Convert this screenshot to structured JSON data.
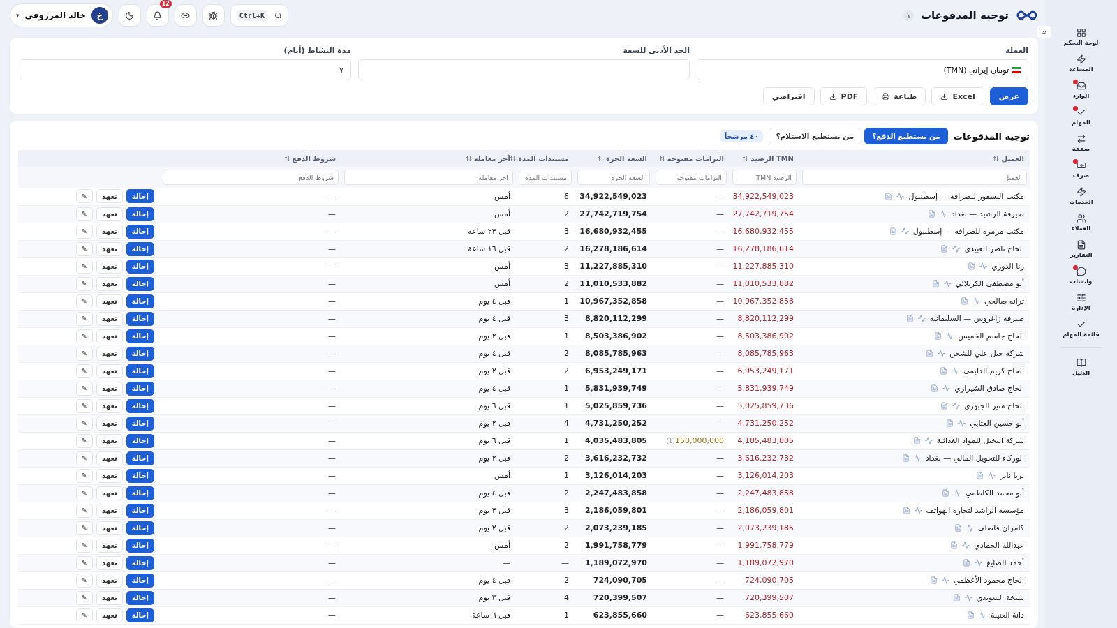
{
  "topbar": {
    "title": "توجيه المدفوعات",
    "help": "؟",
    "user": {
      "name": "خالد المرزوقي",
      "initial": "خ",
      "caret": "▾"
    },
    "notifications": "12",
    "search_shortcut": "Ctrl+K"
  },
  "sidebar": {
    "collapse": "«",
    "items": [
      {
        "label": "لوحة التحكم",
        "dot": false
      },
      {
        "label": "المساعد",
        "dot": false
      },
      {
        "label": "الوارد",
        "dot": true
      },
      {
        "label": "المهام",
        "dot": true
      },
      {
        "label": "صفقة",
        "dot": false
      },
      {
        "label": "صرف",
        "dot": true
      },
      {
        "label": "الخدمات",
        "dot": false
      },
      {
        "label": "العملاء",
        "dot": false
      },
      {
        "label": "التقارير",
        "dot": false
      },
      {
        "label": "واتساب",
        "dot": true
      },
      {
        "label": "الإدارة",
        "dot": false
      },
      {
        "label": "قائمة المهام",
        "dot": false
      },
      {
        "label": "الدليل",
        "dot": false
      }
    ]
  },
  "filters": {
    "fields": [
      {
        "label": "العملة",
        "value": "تومان إيراني (TMN)",
        "flag": true
      },
      {
        "label": "الحد الأدنى للسعة",
        "flag": false
      },
      {
        "label": "مدة النشاط (أيام)",
        "value": "٧",
        "flag": false
      }
    ],
    "buttons": [
      {
        "label": "عرض",
        "kind": "primary"
      },
      {
        "label": "Excel",
        "kind": "download"
      },
      {
        "label": "طباعة",
        "kind": "print"
      },
      {
        "label": "PDF",
        "kind": "download"
      },
      {
        "label": "افتراضي",
        "kind": "plain"
      }
    ]
  },
  "table": {
    "title": "توجيه المدفوعات",
    "tabs": [
      {
        "label": "من يستطيع الدفع؟",
        "selected": true
      },
      {
        "label": "من يستطيع الاستلام؟",
        "selected": false
      }
    ],
    "count_badge": "٤٠ مرشحاً",
    "columns": [
      {
        "label": "العميل",
        "placeholder": "العميل"
      },
      {
        "label": "TMN الرصيد",
        "placeholder": "الرصيد TMN"
      },
      {
        "label": "التزامات مفتوحة",
        "placeholder": "التزامات مفتوحة"
      },
      {
        "label": "السعة الحرة",
        "placeholder": "السعة الحرة"
      },
      {
        "label": "مستندات المدة",
        "placeholder": "مستندات المدة"
      },
      {
        "label": "آخر معاملة",
        "placeholder": "آخر معاملة"
      },
      {
        "label": "شروط الدفع",
        "placeholder": "شروط الدفع"
      }
    ],
    "rows": [
      {
        "client": "مكتب البسفور للصرافة — إسطنبول",
        "balance": "34,922,549,023",
        "commitments": "—",
        "free": "34,922,549,023",
        "docs": "6",
        "last": "أمس",
        "terms": "—",
        "actions": [
          "إحالة",
          "تعهد",
          "✎"
        ]
      },
      {
        "client": "صيرفة الرشيد — بغداد",
        "balance": "27,742,719,754",
        "commitments": "—",
        "free": "27,742,719,754",
        "docs": "2",
        "last": "أمس",
        "terms": "—",
        "actions": [
          "إحالة",
          "تعهد",
          "✎"
        ]
      },
      {
        "client": "مكتب مرمرة للصرافة — إسطنبول",
        "balance": "16,680,932,455",
        "commitments": "—",
        "free": "16,680,932,455",
        "docs": "3",
        "last": "قبل ٢٣ ساعة",
        "terms": "—",
        "actions": [
          "إحالة",
          "تعهد",
          "✎"
        ]
      },
      {
        "client": "الحاج ناصر العبيدي",
        "balance": "16,278,186,614",
        "commitments": "—",
        "free": "16,278,186,614",
        "docs": "2",
        "last": "قبل ١٦ ساعة",
        "terms": "—",
        "actions": [
          "إحالة",
          "تعهد",
          "✎"
        ]
      },
      {
        "client": "رنا الدوري",
        "balance": "11,227,885,310",
        "commitments": "—",
        "free": "11,227,885,310",
        "docs": "3",
        "last": "أمس",
        "terms": "—",
        "actions": [
          "إحالة",
          "تعهد",
          "✎"
        ]
      },
      {
        "client": "أبو مصطفى الكربلائي",
        "balance": "11,010,533,882",
        "commitments": "—",
        "free": "11,010,533,882",
        "docs": "2",
        "last": "أمس",
        "terms": "—",
        "actions": [
          "إحالة",
          "تعهد",
          "✎"
        ]
      },
      {
        "client": "ترانه صالحي",
        "balance": "10,967,352,858",
        "commitments": "—",
        "free": "10,967,352,858",
        "docs": "1",
        "last": "قبل ٤ يوم",
        "terms": "—",
        "actions": [
          "إحالة",
          "تعهد",
          "✎"
        ]
      },
      {
        "client": "صيرفة زاغروس — السليمانية",
        "balance": "8,820,112,299",
        "commitments": "—",
        "free": "8,820,112,299",
        "docs": "3",
        "last": "قبل ٤ يوم",
        "terms": "—",
        "actions": [
          "إحالة",
          "تعهد",
          "✎"
        ]
      },
      {
        "client": "الحاج جاسم الخميس",
        "balance": "8,503,386,902",
        "commitments": "—",
        "free": "8,503,386,902",
        "docs": "1",
        "last": "قبل ٢ يوم",
        "terms": "—",
        "actions": [
          "إحالة",
          "تعهد",
          "✎"
        ]
      },
      {
        "client": "شركة جبل علي للشحن",
        "balance": "8,085,785,963",
        "commitments": "—",
        "free": "8,085,785,963",
        "docs": "2",
        "last": "قبل ٤ يوم",
        "terms": "—",
        "actions": [
          "إحالة",
          "تعهد",
          "✎"
        ]
      },
      {
        "client": "الحاج كريم الدليمي",
        "balance": "6,953,249,171",
        "commitments": "—",
        "free": "6,953,249,171",
        "docs": "2",
        "last": "قبل ٢ يوم",
        "terms": "—",
        "actions": [
          "إحالة",
          "تعهد",
          "✎"
        ]
      },
      {
        "client": "الحاج صادق الشيرازي",
        "balance": "5,831,939,749",
        "commitments": "—",
        "free": "5,831,939,749",
        "docs": "1",
        "last": "قبل ٤ يوم",
        "terms": "—",
        "actions": [
          "إحالة",
          "تعهد",
          "✎"
        ]
      },
      {
        "client": "الحاج منير الجبوري",
        "balance": "5,025,859,736",
        "commitments": "—",
        "free": "5,025,859,736",
        "docs": "1",
        "last": "قبل ٦ يوم",
        "terms": "—",
        "actions": [
          "إحالة",
          "تعهد",
          "✎"
        ]
      },
      {
        "client": "أبو حسين العتابي",
        "balance": "4,731,250,252",
        "commitments": "—",
        "free": "4,731,250,252",
        "docs": "4",
        "last": "قبل ٢ يوم",
        "terms": "—",
        "actions": [
          "إحالة",
          "تعهد",
          "✎"
        ]
      },
      {
        "client": "شركة النخيل للمواد الغذائية",
        "balance": "4,185,483,805",
        "commitments": "150,000,000",
        "commitments_count": "(1)",
        "free": "4,035,483,805",
        "docs": "1",
        "last": "قبل ٦ يوم",
        "terms": "—",
        "actions": [
          "إحالة",
          "تعهد",
          "✎"
        ]
      },
      {
        "client": "الوركاء للتحويل المالي — بغداد",
        "balance": "3,616,232,732",
        "commitments": "—",
        "free": "3,616,232,732",
        "docs": "2",
        "last": "قبل ٢ يوم",
        "terms": "—",
        "actions": [
          "إحالة",
          "تعهد",
          "✎"
        ]
      },
      {
        "client": "بريا ناير",
        "balance": "3,126,014,203",
        "commitments": "—",
        "free": "3,126,014,203",
        "docs": "1",
        "last": "أمس",
        "terms": "—",
        "actions": [
          "إحالة",
          "تعهد",
          "✎"
        ]
      },
      {
        "client": "أبو محمد الكاظمي",
        "balance": "2,247,483,858",
        "commitments": "—",
        "free": "2,247,483,858",
        "docs": "2",
        "last": "قبل ٤ يوم",
        "terms": "—",
        "actions": [
          "إحالة",
          "تعهد",
          "✎"
        ]
      },
      {
        "client": "مؤسسة الراشد لتجارة الهواتف",
        "balance": "2,186,059,801",
        "commitments": "—",
        "free": "2,186,059,801",
        "docs": "3",
        "last": "قبل ٣ يوم",
        "terms": "—",
        "actions": [
          "إحالة",
          "تعهد",
          "✎"
        ]
      },
      {
        "client": "كامران فاضلي",
        "balance": "2,073,239,185",
        "commitments": "—",
        "free": "2,073,239,185",
        "docs": "2",
        "last": "قبل ٢ يوم",
        "terms": "—",
        "actions": [
          "إحالة",
          "تعهد",
          "✎"
        ]
      },
      {
        "client": "عبدالله الحمادي",
        "balance": "1,991,758,779",
        "commitments": "—",
        "free": "1,991,758,779",
        "docs": "2",
        "last": "أمس",
        "terms": "—",
        "actions": [
          "إحالة",
          "تعهد",
          "✎"
        ]
      },
      {
        "client": "أحمد الصايغ",
        "balance": "1,189,072,970",
        "commitments": "—",
        "free": "1,189,072,970",
        "docs": "—",
        "last": "—",
        "terms": "—",
        "actions": [
          "إحالة",
          "تعهد",
          "✎"
        ]
      },
      {
        "client": "الحاج محمود الأعظمي",
        "balance": "724,090,705",
        "commitments": "—",
        "free": "724,090,705",
        "docs": "2",
        "last": "قبل ٤ يوم",
        "terms": "—",
        "actions": [
          "إحالة",
          "تعهد",
          "✎"
        ]
      },
      {
        "client": "شيخة السويدي",
        "balance": "720,399,507",
        "commitments": "—",
        "free": "720,399,507",
        "docs": "4",
        "last": "قبل ٣ يوم",
        "terms": "—",
        "actions": [
          "إحالة",
          "تعهد",
          "✎"
        ]
      },
      {
        "client": "دانة العتيبة",
        "balance": "623,855,660",
        "commitments": "—",
        "free": "623,855,660",
        "docs": "1",
        "last": "قبل ٦ ساعة",
        "terms": "—",
        "actions": [
          "إحالة",
          "تعهد",
          "✎"
        ]
      }
    ]
  }
}
